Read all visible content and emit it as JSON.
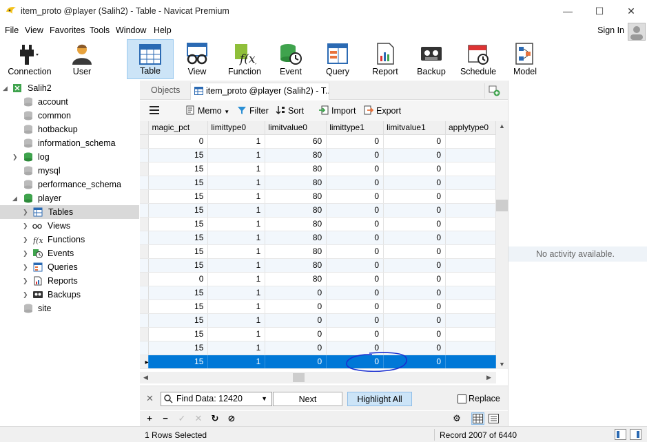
{
  "window": {
    "title": "item_proto @player (Salih2) - Table - Navicat Premium",
    "minimize_glyph": "—",
    "maximize_glyph": "☐",
    "close_glyph": "✕"
  },
  "menu": {
    "items": [
      "File",
      "View",
      "Favorites",
      "Tools",
      "Window",
      "Help"
    ],
    "sign_in": "Sign In"
  },
  "toolbar": {
    "buttons": [
      "Connection",
      "User",
      "Table",
      "View",
      "Function",
      "Event",
      "Query",
      "Report",
      "Backup",
      "Schedule",
      "Model"
    ],
    "active": "Table"
  },
  "tree": {
    "connection": "Salih2",
    "databases_top": [
      "account",
      "common",
      "hotbackup",
      "information_schema",
      "log",
      "mysql",
      "performance_schema",
      "player"
    ],
    "player_children": [
      "Tables",
      "Views",
      "Functions",
      "Events",
      "Queries",
      "Reports",
      "Backups"
    ],
    "databases_bottom": [
      "site"
    ]
  },
  "tabs": {
    "objects": "Objects",
    "active": "item_proto @player (Salih2) - T..."
  },
  "subtoolbar": {
    "memo": "Memo",
    "filter": "Filter",
    "sort": "Sort",
    "import": "Import",
    "export": "Export"
  },
  "grid": {
    "columns": [
      "magic_pct",
      "limittype0",
      "limitvalue0",
      "limittype1",
      "limitvalue1",
      "applytype0"
    ],
    "rows": [
      [
        "0",
        "1",
        "60",
        "0",
        "0",
        ""
      ],
      [
        "15",
        "1",
        "80",
        "0",
        "0",
        ""
      ],
      [
        "15",
        "1",
        "80",
        "0",
        "0",
        ""
      ],
      [
        "15",
        "1",
        "80",
        "0",
        "0",
        ""
      ],
      [
        "15",
        "1",
        "80",
        "0",
        "0",
        ""
      ],
      [
        "15",
        "1",
        "80",
        "0",
        "0",
        ""
      ],
      [
        "15",
        "1",
        "80",
        "0",
        "0",
        ""
      ],
      [
        "15",
        "1",
        "80",
        "0",
        "0",
        ""
      ],
      [
        "15",
        "1",
        "80",
        "0",
        "0",
        ""
      ],
      [
        "15",
        "1",
        "80",
        "0",
        "0",
        ""
      ],
      [
        "0",
        "1",
        "80",
        "0",
        "0",
        ""
      ],
      [
        "15",
        "1",
        "0",
        "0",
        "0",
        ""
      ],
      [
        "15",
        "1",
        "0",
        "0",
        "0",
        ""
      ],
      [
        "15",
        "1",
        "0",
        "0",
        "0",
        ""
      ],
      [
        "15",
        "1",
        "0",
        "0",
        "0",
        ""
      ],
      [
        "15",
        "1",
        "0",
        "0",
        "0",
        ""
      ],
      [
        "15",
        "1",
        "0",
        "0",
        "0",
        ""
      ]
    ],
    "selected_row_index": 16,
    "current_row_marker": "▸"
  },
  "find": {
    "value": "Find Data: 12420",
    "next": "Next",
    "highlight_all": "Highlight All",
    "replace": "Replace"
  },
  "bottom_tools": [
    "+",
    "−",
    "✓",
    "✕",
    "↻",
    "⊘"
  ],
  "right_pane": {
    "message": "No activity available."
  },
  "status": {
    "selection": "1 Rows Selected",
    "record": "Record 2007 of 6440"
  },
  "colors": {
    "selection": "#0078d7",
    "toolbar_active": "#cce4f7",
    "annotation": "#1a2fd0"
  }
}
